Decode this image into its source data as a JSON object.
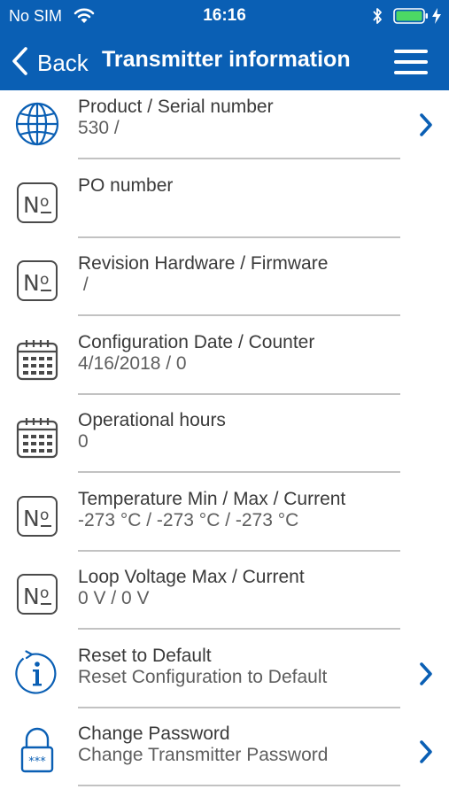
{
  "status_bar": {
    "carrier": "No SIM",
    "time": "16:16"
  },
  "nav": {
    "back_label": "Back",
    "title": "Transmitter information"
  },
  "colors": {
    "header_bg": "#0a5fb4",
    "accent": "#0a5fb4",
    "battery": "#4cd964"
  },
  "rows": [
    {
      "icon": "globe-icon",
      "title": "Product / Serial number",
      "value": "530 /",
      "has_chevron": true
    },
    {
      "icon": "numero-icon",
      "title": "PO number",
      "value": "",
      "has_chevron": false
    },
    {
      "icon": "numero-icon",
      "title": "Revision Hardware / Firmware",
      "value": " /",
      "has_chevron": false
    },
    {
      "icon": "calendar-icon",
      "title": "Configuration Date / Counter",
      "value": "4/16/2018 / 0",
      "has_chevron": false
    },
    {
      "icon": "calendar-icon",
      "title": "Operational hours",
      "value": "0",
      "has_chevron": false
    },
    {
      "icon": "numero-icon",
      "title": "Temperature Min / Max / Current",
      "value": "-273 °C / -273 °C / -273 °C",
      "has_chevron": false
    },
    {
      "icon": "numero-icon",
      "title": "Loop Voltage Max / Current",
      "value": "0 V / 0 V",
      "has_chevron": false
    },
    {
      "icon": "info-reset-icon",
      "title": "Reset to Default",
      "value": "Reset Configuration to Default",
      "has_chevron": true
    },
    {
      "icon": "lock-icon",
      "title": "Change Password",
      "value": "Change Transmitter Password",
      "has_chevron": true
    }
  ]
}
